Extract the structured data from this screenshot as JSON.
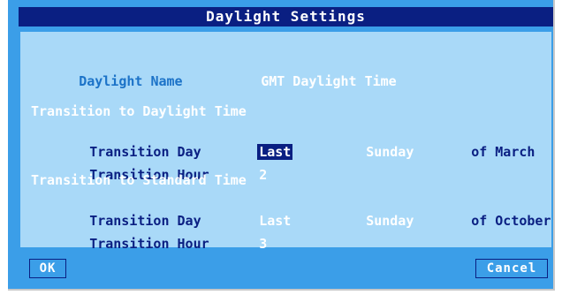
{
  "title": "Daylight Settings",
  "daylight_name": {
    "label": "Daylight Name",
    "value": "GMT Daylight Time"
  },
  "to_daylight": {
    "heading": "Transition to Daylight Time",
    "day_label": "Transition Day",
    "day_ordinal": "Last",
    "day_weekday": "Sunday",
    "day_of_month": "of March",
    "hour_label": "Transition Hour",
    "hour_value": "2"
  },
  "to_standard": {
    "heading": "Transition to Standard Time",
    "day_label": "Transition Day",
    "day_ordinal": "Last",
    "day_weekday": "Sunday",
    "day_of_month": "of October",
    "hour_label": "Transition Hour",
    "hour_value": "3"
  },
  "buttons": {
    "ok": "OK",
    "cancel": "Cancel"
  },
  "colors": {
    "frame": "#3b9ee8",
    "panel": "#a9d9f8",
    "title_bar": "#0a1f82",
    "selection": "#0a1f82"
  }
}
